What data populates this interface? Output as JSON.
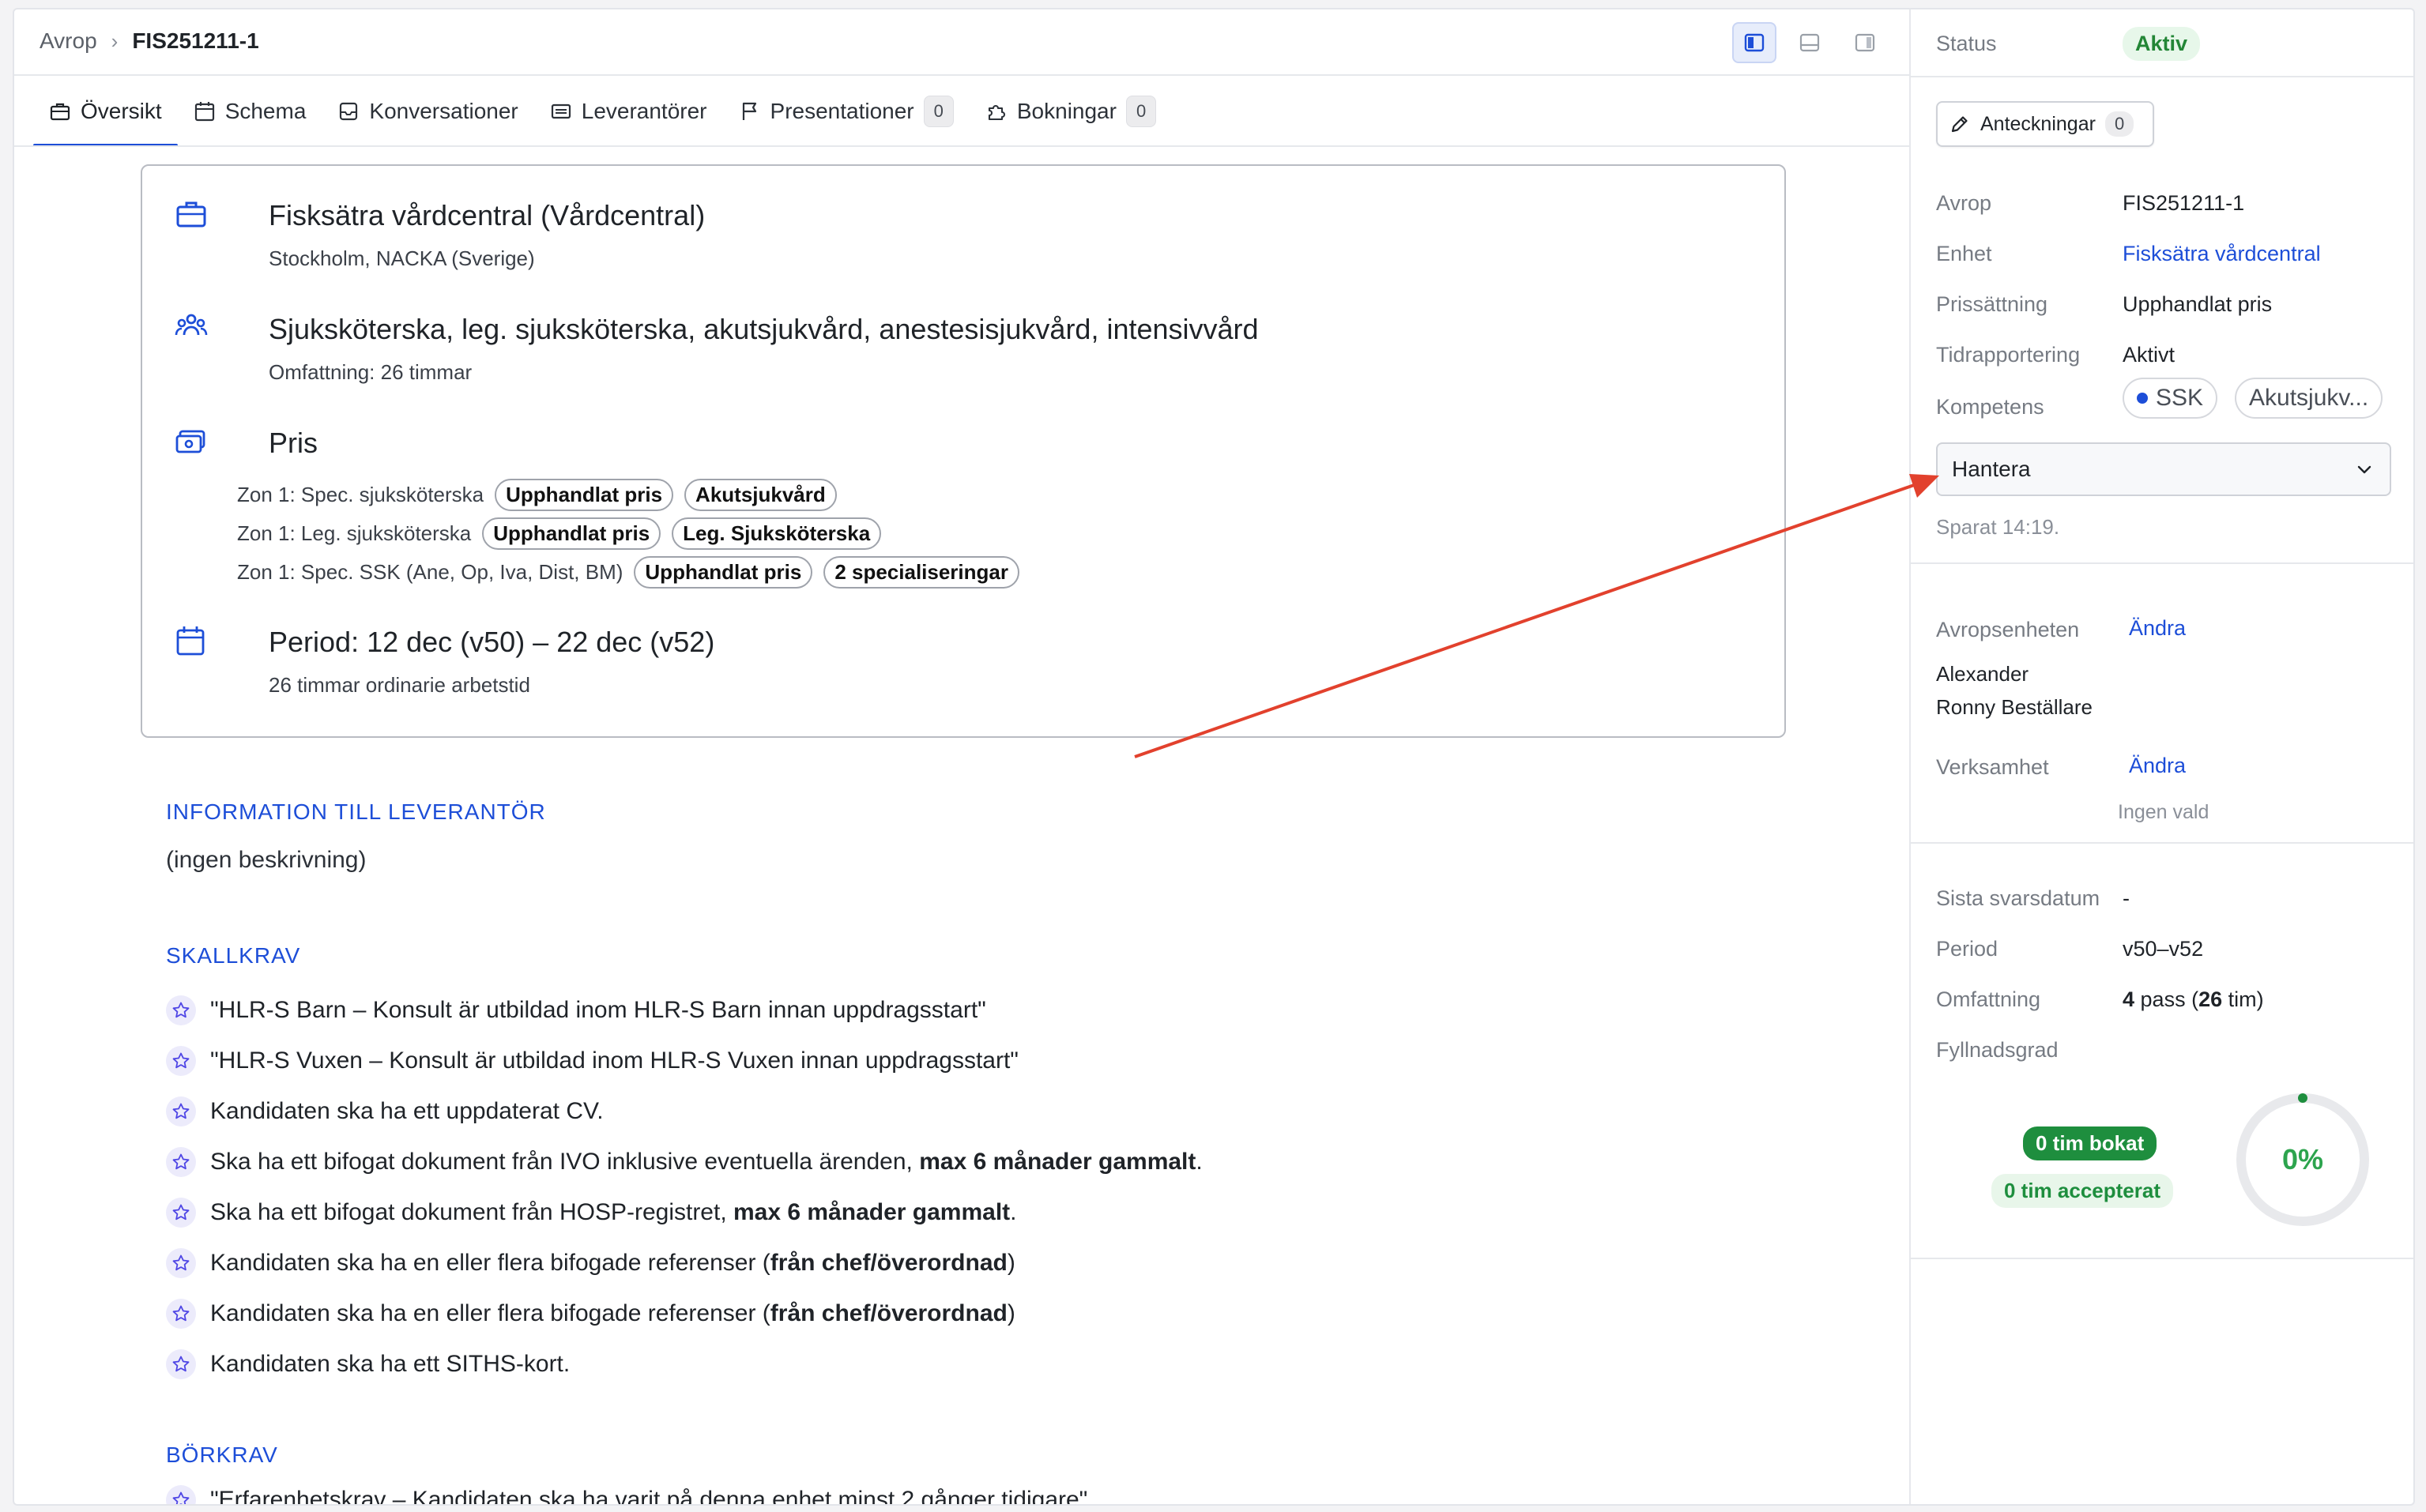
{
  "breadcrumb": {
    "root": "Avrop",
    "current": "FIS251211-1"
  },
  "layout_toggle": {
    "icons": [
      "panel-left-icon",
      "panel-bottom-icon",
      "panel-right-icon"
    ],
    "active": 0
  },
  "tabs": [
    {
      "label": "Översikt",
      "icon": "briefcase-icon",
      "active": true
    },
    {
      "label": "Schema",
      "icon": "calendar-icon"
    },
    {
      "label": "Konversationer",
      "icon": "inbox-icon"
    },
    {
      "label": "Leverantörer",
      "icon": "list-icon"
    },
    {
      "label": "Presentationer",
      "icon": "flag-icon",
      "count": "0"
    },
    {
      "label": "Bokningar",
      "icon": "puzzle-icon",
      "count": "0"
    }
  ],
  "summary_card": {
    "unit": {
      "title": "Fisksätra vårdcentral (Vårdcentral)",
      "subtitle": "Stockholm, NACKA (Sverige)",
      "icon": "briefcase-icon"
    },
    "competence": {
      "title": "Sjuksköterska, leg. sjuksköterska, akutsjukvård, anestesisjukvård, intensivvård",
      "subtitle": "Omfattning: 26 timmar",
      "icon": "users-icon"
    },
    "price": {
      "title": "Pris",
      "icon": "money-icon",
      "zones": [
        {
          "label": "Zon 1: Spec. sjuksköterska",
          "pills": [
            "Upphandlat pris",
            "Akutsjukvård"
          ]
        },
        {
          "label": "Zon 1: Leg. sjuksköterska",
          "pills": [
            "Upphandlat pris",
            "Leg. Sjuksköterska"
          ]
        },
        {
          "label": "Zon 1: Spec. SSK (Ane, Op, Iva, Dist, BM)",
          "pills": [
            "Upphandlat pris",
            "2 specialiseringar"
          ]
        }
      ]
    },
    "period": {
      "title": "Period: 12 dec (v50) – 22 dec (v52)",
      "subtitle": "26 timmar ordinarie arbetstid",
      "icon": "calendar-icon"
    }
  },
  "info_section": {
    "heading": "INFORMATION TILL LEVERANTÖR",
    "text": "(ingen beskrivning)"
  },
  "skallkrav": {
    "heading": "SKALLKRAV",
    "items": [
      [
        "\"HLR-S Barn – Konsult är utbildad inom HLR-S Barn innan uppdragsstart\"",
        "",
        ""
      ],
      [
        "\"HLR-S Vuxen – Konsult är utbildad inom HLR-S Vuxen innan uppdragsstart\"",
        "",
        ""
      ],
      [
        "Kandidaten ska ha ett uppdaterat CV.",
        "",
        ""
      ],
      [
        "Ska ha ett bifogat dokument från IVO inklusive eventuella ärenden, ",
        "max 6 månader gammalt",
        "."
      ],
      [
        "Ska ha ett bifogat dokument från HOSP-registret, ",
        "max 6 månader gammalt",
        "."
      ],
      [
        "Kandidaten ska ha en eller flera bifogade referenser (",
        "från chef/överordnad",
        ")"
      ],
      [
        "Kandidaten ska ha en eller flera bifogade referenser (",
        "från chef/överordnad",
        ")"
      ],
      [
        "Kandidaten ska ha ett SITHS-kort.",
        "",
        ""
      ]
    ]
  },
  "borkrav": {
    "heading": "BÖRKRAV",
    "items": [
      "\"Erfarenhetskrav – Kandidaten ska ha varit på denna enhet minst 2 gånger tidigare\""
    ]
  },
  "sidebar": {
    "status_label": "Status",
    "status_value": "Aktiv",
    "notes_button": {
      "label": "Anteckningar",
      "count": "0"
    },
    "fields": [
      {
        "label": "Avrop",
        "value": "FIS251211-1"
      },
      {
        "label": "Enhet",
        "value": "Fisksätra vårdcentral",
        "link": true
      },
      {
        "label": "Prissättning",
        "value": "Upphandlat pris"
      },
      {
        "label": "Tidrapportering",
        "value": "Aktivt"
      }
    ],
    "kompetens_label": "Kompetens",
    "kompetens_chips": [
      "SSK",
      "Akutsjukv..."
    ],
    "manage_select": "Hantera",
    "saved_text": "Sparat 14:19.",
    "avropsenheten": {
      "label": "Avropsenheten",
      "action": "Ändra",
      "names": [
        "Alexander",
        "Ronny Beställare"
      ]
    },
    "verksamhet": {
      "label": "Verksamhet",
      "action": "Ändra",
      "empty": "Ingen vald"
    },
    "stats": [
      {
        "label": "Sista svarsdatum",
        "value": "-"
      },
      {
        "label": "Period",
        "value": "v50–v52"
      }
    ],
    "omfattning": {
      "label": "Omfattning",
      "pass_count": "4",
      "pass_text": " pass (",
      "hours": "26",
      "hours_text": " tim)"
    },
    "fyllnadsgrad": {
      "label": "Fyllnadsgrad",
      "booked": "0 tim bokat",
      "accepted": "0 tim accepterat",
      "percent_text": "0%",
      "fraction": 0
    }
  },
  "colors": {
    "accent": "#1d4ed8",
    "success": "#238636",
    "success_bg": "#e7f7ea",
    "annotation_arrow": "#e2412d"
  }
}
